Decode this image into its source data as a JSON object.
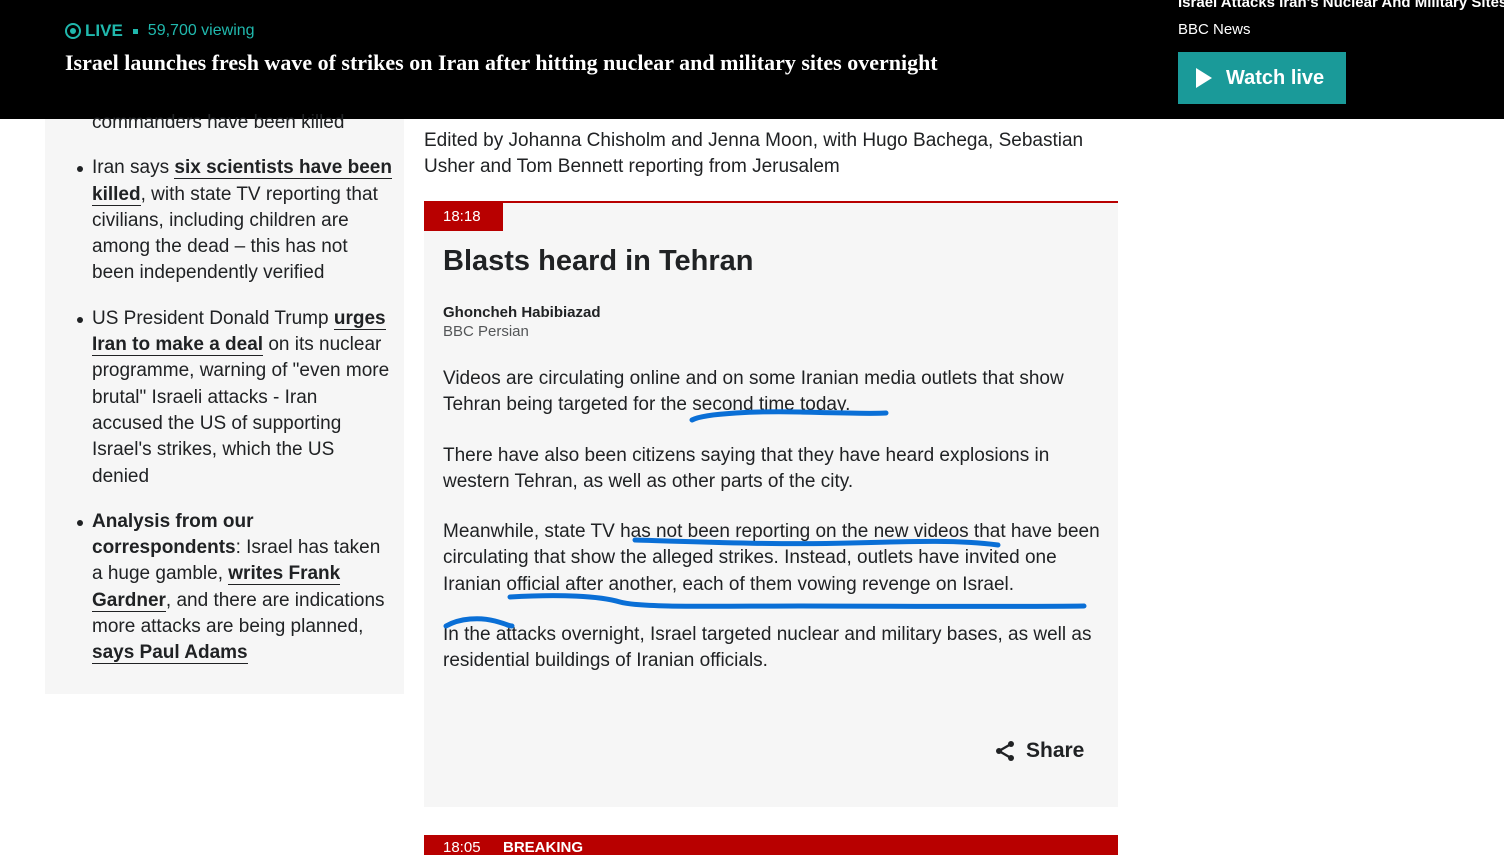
{
  "topbar": {
    "live_label": "LIVE",
    "viewers": "59,700 viewing",
    "headline": "Israel launches fresh wave of strikes on Iran after hitting nuclear and military sites overnight",
    "stream_title": "Israel Attacks Iran's Nuclear And Military Sites",
    "stream_source": "BBC News",
    "watch_label": "Watch live",
    "accent": "#1a9a99"
  },
  "summary": {
    "item0_cut": "commanders have been killed",
    "item1": {
      "pre": "Iran says ",
      "link": "six scientists have been killed",
      "post": ", with state TV reporting that civilians, including children are among the dead – this has not been independently verified"
    },
    "item2": {
      "pre": "US President Donald Trump ",
      "link": "urges Iran to make a deal",
      "post": " on its nuclear programme, warning of \"even more brutal\" Israeli attacks - Iran accused the US of supporting Israel's strikes, which the US denied"
    },
    "item3": {
      "bold": "Analysis from our correspondents",
      "mid1": ": Israel has taken a huge gamble, ",
      "link1": "writes Frank Gardner",
      "mid2": ", and there are indications more attacks are being planned,",
      "link2": " says Paul Adams"
    }
  },
  "editors": "Edited by Johanna Chisholm and Jenna Moon, with Hugo Bachega, Sebastian Usher and Tom Bennett reporting from Jerusalem",
  "post": {
    "time": "18:18",
    "title": "Blasts heard in Tehran",
    "author": "Ghoncheh Habibiazad",
    "author_org": "BBC Persian",
    "paragraphs": [
      "Videos are circulating online and on some Iranian media outlets that show Tehran being targeted for the second time today.",
      "There have also been citizens saying that they have heard explosions in western Tehran, as well as other parts of the city.",
      "Meanwhile, state TV has not been reporting on the new videos that have been circulating that show the alleged strikes. Instead, outlets have invited one Iranian official after another, each of them vowing revenge on Israel.",
      "In the attacks overnight, Israel targeted nuclear and military bases, as well as residential buildings of Iranian officials."
    ],
    "share_label": "Share",
    "accent": "#b80000"
  },
  "next_post": {
    "time": "18:05",
    "label": "BREAKING"
  },
  "annotation_color": "#0a6fd6"
}
